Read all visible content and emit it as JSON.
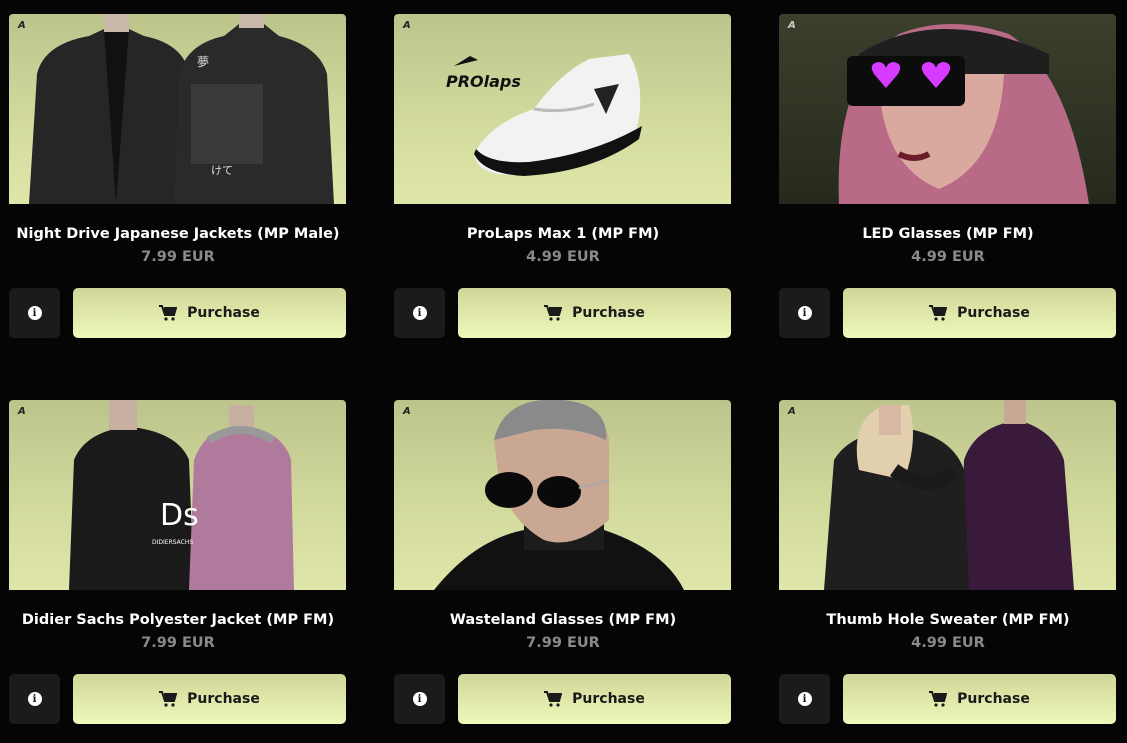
{
  "products": [
    {
      "title": "Night Drive Japanese Jackets (MP Male)",
      "price": "7.99 EUR",
      "purchase_label": "Purchase",
      "theme": "light"
    },
    {
      "title": "ProLaps Max 1 (MP FM)",
      "price": "4.99 EUR",
      "purchase_label": "Purchase",
      "theme": "light",
      "logo_text": "PROlaps"
    },
    {
      "title": "LED Glasses (MP FM)",
      "price": "4.99 EUR",
      "purchase_label": "Purchase",
      "theme": "dark"
    },
    {
      "title": "Didier Sachs Polyester Jacket (MP FM)",
      "price": "7.99 EUR",
      "purchase_label": "Purchase",
      "theme": "light",
      "logo_text": "Ds",
      "logo_subtext": "DIDIERSACHS"
    },
    {
      "title": "Wasteland Glasses (MP FM)",
      "price": "7.99 EUR",
      "purchase_label": "Purchase",
      "theme": "light"
    },
    {
      "title": "Thumb Hole Sweater (MP FM)",
      "price": "4.99 EUR",
      "purchase_label": "Purchase",
      "theme": "light"
    }
  ],
  "icons": {
    "info": "info-icon",
    "cart": "cart-icon"
  },
  "colors": {
    "background": "#050505",
    "purchase_gradient_top": "#cfd697",
    "purchase_gradient_bottom": "#f0f7bb",
    "price": "#8a8a8a",
    "led": "#d63bff"
  }
}
